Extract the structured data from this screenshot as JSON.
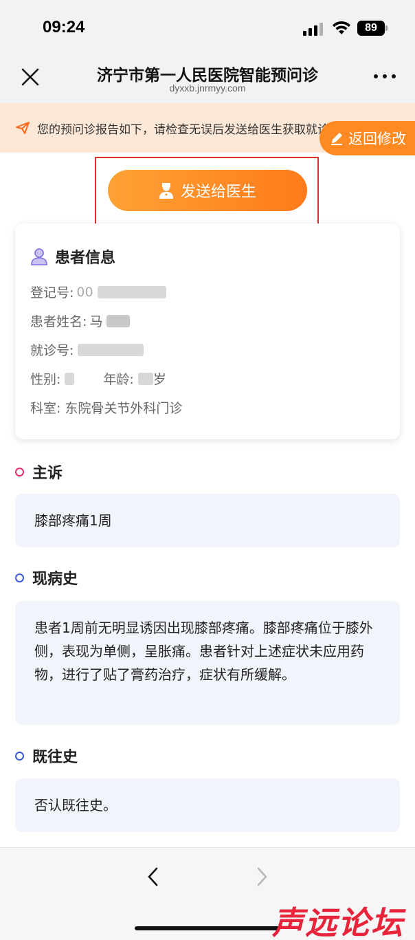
{
  "status_bar": {
    "time": "09:24",
    "battery": "89"
  },
  "nav": {
    "title": "济宁市第一人民医院智能预问诊",
    "url": "dyxxb.jnrmyy.com"
  },
  "notice": {
    "text": "您的预问诊报告如下，请检查无误后发送给医生获取就诊指导"
  },
  "return_button": {
    "label": "返回修改"
  },
  "send_button": {
    "label": "发送给医生"
  },
  "patient": {
    "title": "患者信息",
    "reg_label": "登记号:",
    "reg_value": "00",
    "name_label": "患者姓名:",
    "name_value": "马",
    "visit_label": "就诊号:",
    "gender_label": "性别:",
    "age_label": "年龄:",
    "age_unit": "岁",
    "dept_label": "科室:",
    "dept_value": "东院骨关节外科门诊"
  },
  "sections": [
    {
      "title": "主诉",
      "content": "膝部疼痛1周"
    },
    {
      "title": "现病史",
      "content": "患者1周前无明显诱因出现膝部疼痛。膝部疼痛位于膝外侧，表现为单侧，呈胀痛。患者针对上述症状未应用药物，进行了贴了膏药治疗，症状有所缓解。"
    },
    {
      "title": "既往史",
      "content": "否认既往史。"
    }
  ],
  "watermark": "声远论坛",
  "colors": {
    "accent": "#ff8a22",
    "section_bg": "#f2f4fc",
    "highlight_border": "#e0302a"
  }
}
